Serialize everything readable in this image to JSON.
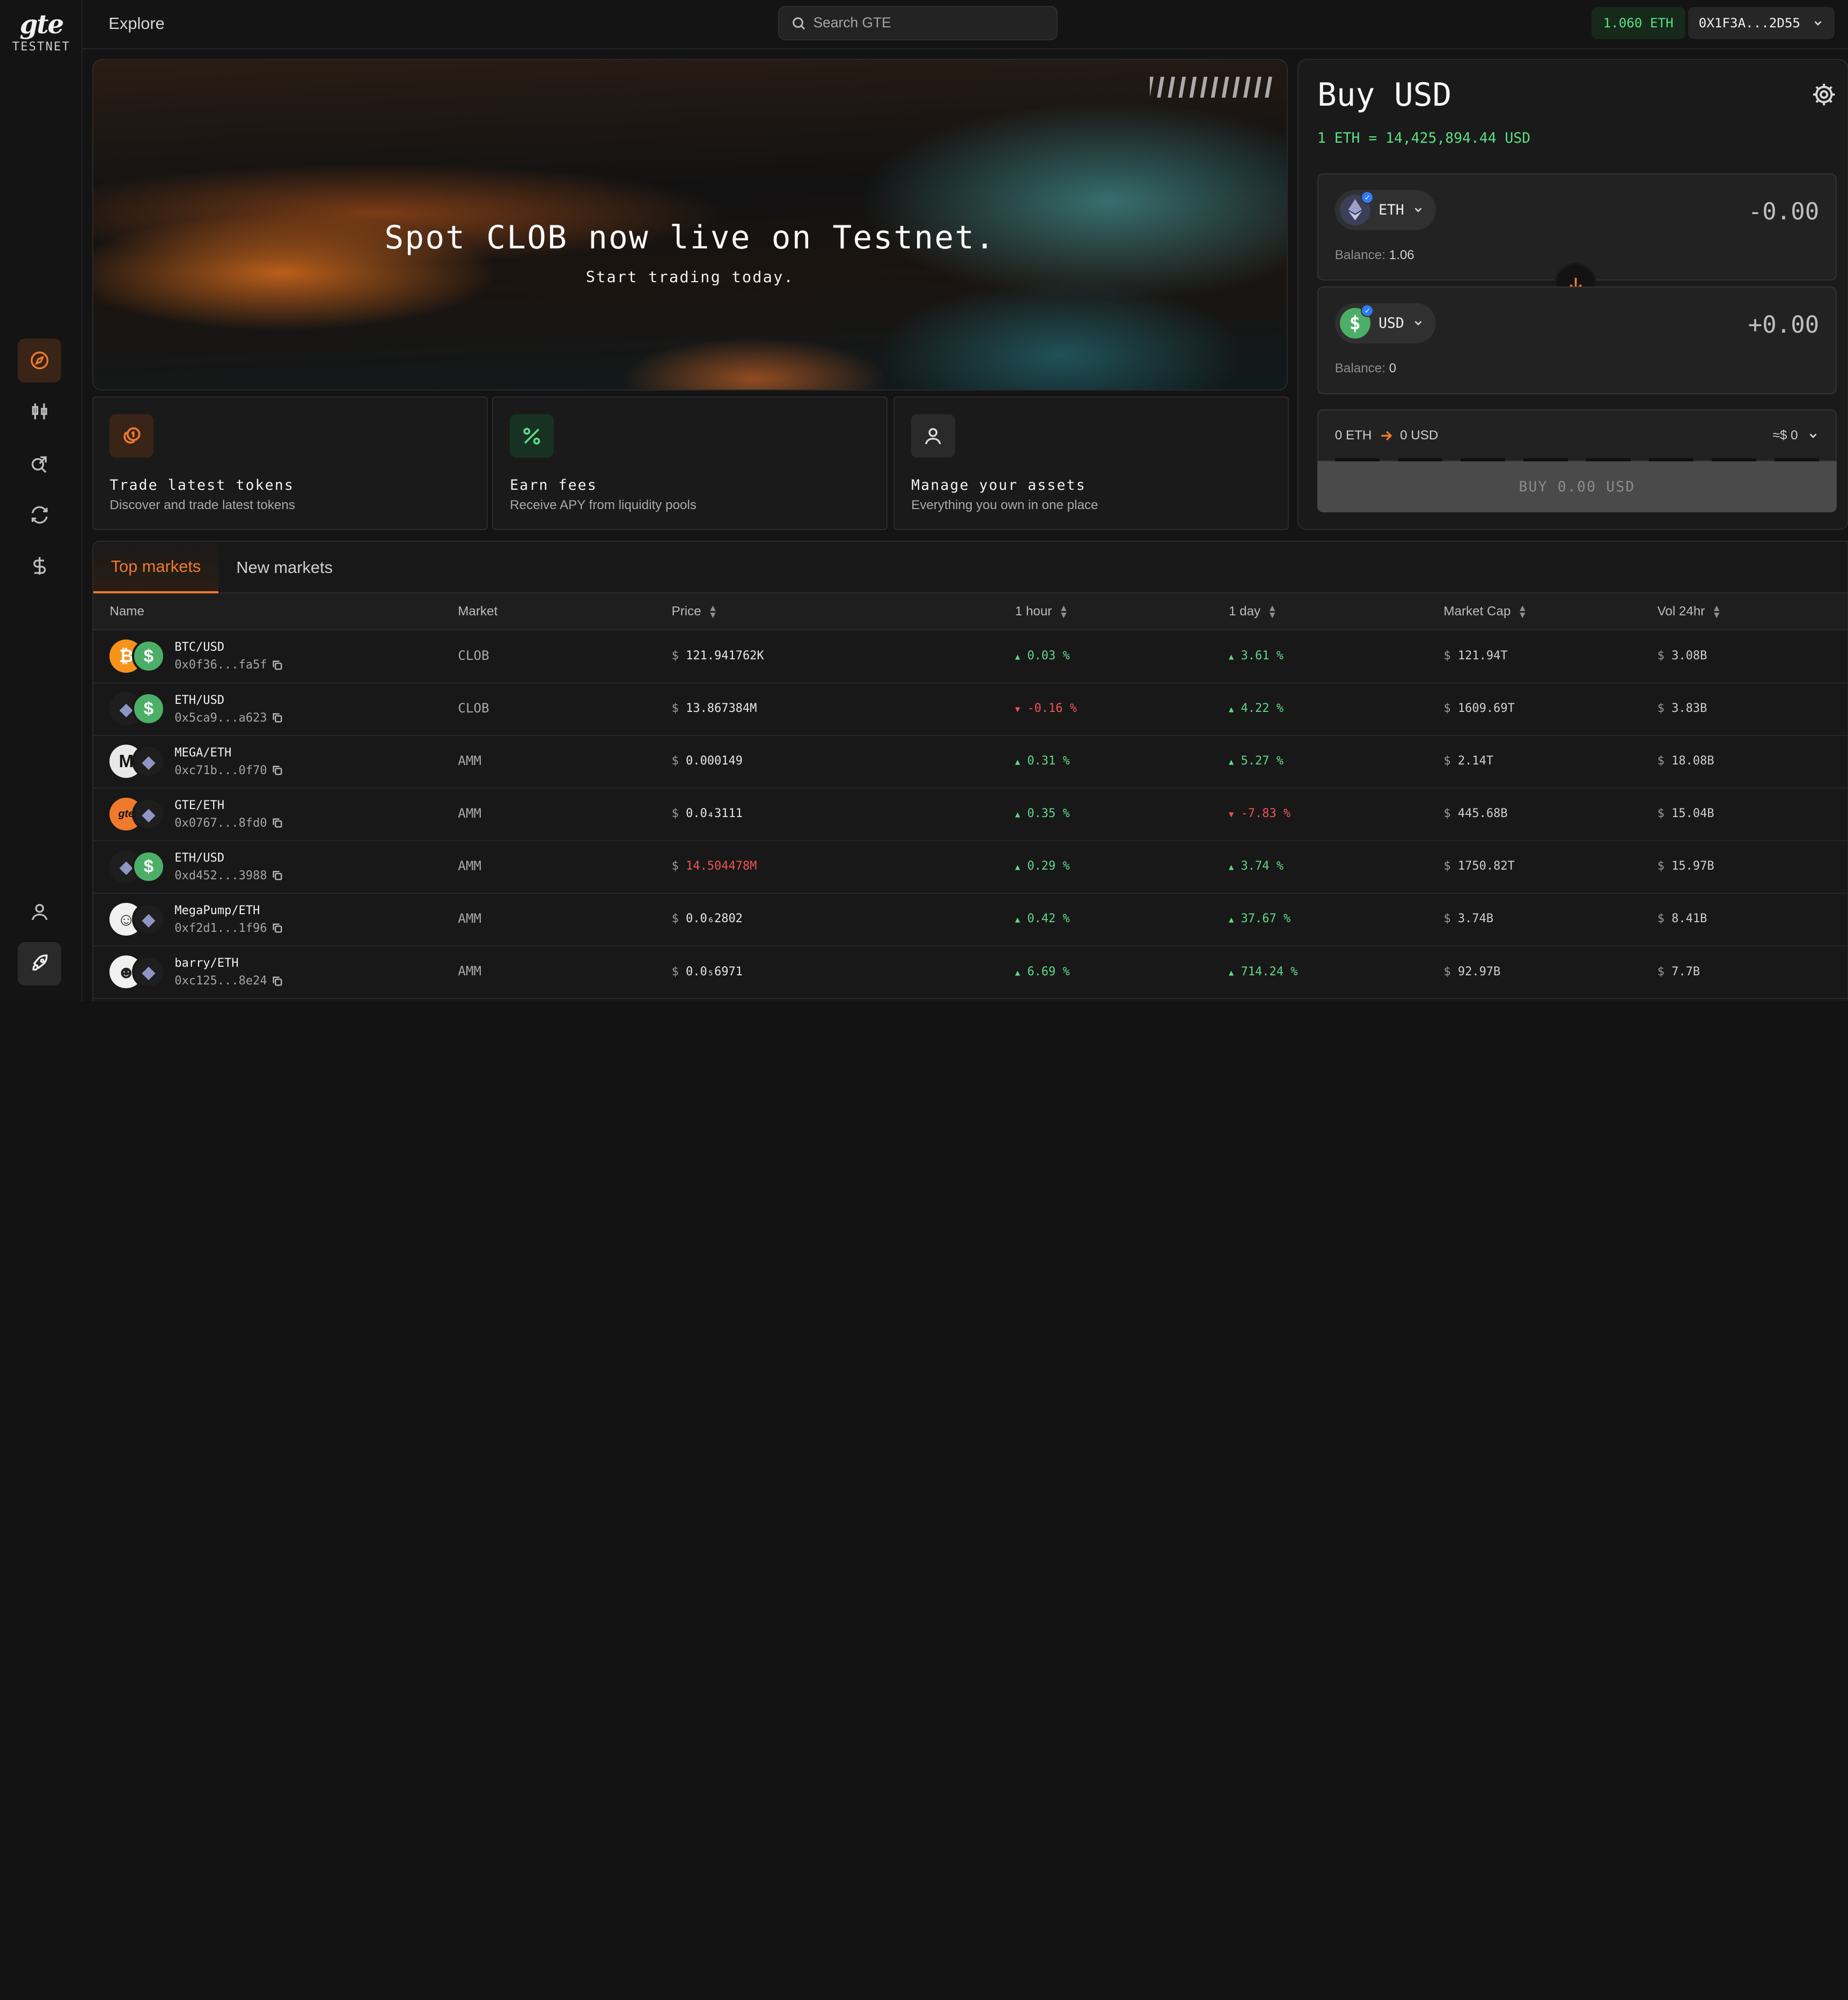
{
  "brand": {
    "logo": "gte",
    "network": "TESTNET"
  },
  "topbar": {
    "section": "Explore",
    "search_placeholder": "Search GTE",
    "eth_balance": "1.060 ETH",
    "wallet": "0X1F3A...2D55"
  },
  "hero": {
    "title": "Spot CLOB now live on Testnet.",
    "subtitle": "Start trading today."
  },
  "cards": [
    {
      "title": "Trade latest tokens",
      "desc": "Discover and trade latest tokens"
    },
    {
      "title": "Earn fees",
      "desc": "Receive APY from liquidity pools"
    },
    {
      "title": "Manage your assets",
      "desc": "Everything you own in one place"
    }
  ],
  "swap": {
    "title": "Buy USD",
    "rate": "1 ETH = 14,425,894.44 USD",
    "from": {
      "symbol": "ETH",
      "amount": "-0.00",
      "balance_label": "Balance:",
      "balance": "1.06"
    },
    "to": {
      "symbol": "USD",
      "amount": "+0.00",
      "balance_label": "Balance:",
      "balance": "0"
    },
    "route_from": "0 ETH",
    "route_to": "0 USD",
    "fee": "≈$ 0",
    "buy_label": "BUY 0.00 USD"
  },
  "markets": {
    "tabs": [
      "Top markets",
      "New markets"
    ],
    "columns": [
      "Name",
      "Market",
      "Price",
      "1 hour",
      "1 day",
      "Market Cap",
      "Vol 24hr"
    ],
    "currency": "$",
    "rows": [
      {
        "pair": "BTC/USD",
        "addr": "0x0f36...fa5f",
        "market": "CLOB",
        "price": "121.941762K",
        "h1": "0.03 %",
        "d1": "3.61 %",
        "mcap": "121.94T",
        "vol": "3.08B"
      },
      {
        "pair": "ETH/USD",
        "addr": "0x5ca9...a623",
        "market": "CLOB",
        "price": "13.867384M",
        "h1": "-0.16 %",
        "d1": "4.22 %",
        "mcap": "1609.69T",
        "vol": "3.83B"
      },
      {
        "pair": "MEGA/ETH",
        "addr": "0xc71b...0f70",
        "market": "AMM",
        "price": "0.000149",
        "h1": "0.31 %",
        "d1": "5.27 %",
        "mcap": "2.14T",
        "vol": "18.08B"
      },
      {
        "pair": "GTE/ETH",
        "addr": "0x0767...8fd0",
        "market": "AMM",
        "price": "0.0₄3111",
        "h1": "0.35 %",
        "d1": "-7.83 %",
        "mcap": "445.68B",
        "vol": "15.04B"
      },
      {
        "pair": "ETH/USD",
        "addr": "0xd452...3988",
        "market": "AMM",
        "price": "14.504478M",
        "h1": "0.29 %",
        "d1": "3.74 %",
        "mcap": "1750.82T",
        "vol": "15.97B"
      },
      {
        "pair": "MegaPump/ETH",
        "addr": "0xf2d1...1f96",
        "market": "AMM",
        "price": "0.0₆2802",
        "h1": "0.42 %",
        "d1": "37.67 %",
        "mcap": "3.74B",
        "vol": "8.41B"
      },
      {
        "pair": "barry/ETH",
        "addr": "0xc125...8e24",
        "market": "AMM",
        "price": "0.0₅6971",
        "h1": "6.69 %",
        "d1": "714.24 %",
        "mcap": "92.97B",
        "vol": "7.7B"
      }
    ]
  },
  "colors": {
    "accent": "#f07a2c",
    "positive": "#5fd888",
    "negative": "#ef5353"
  }
}
